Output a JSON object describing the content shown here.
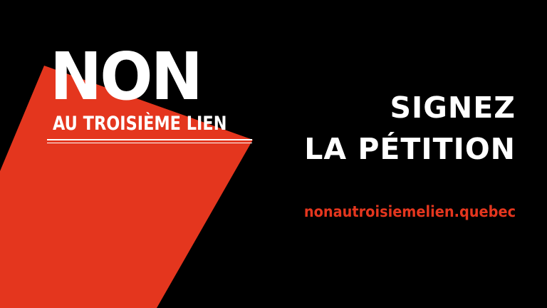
{
  "logo": {
    "headline": "NON",
    "subline": "AU TROISIÈME LIEN"
  },
  "call_to_action": {
    "line1": "SIGNEZ",
    "line2": "LA PÉTITION"
  },
  "website": "nonautroisiemelien.quebec",
  "colors": {
    "background": "#000000",
    "accent": "#e4361e",
    "text": "#ffffff"
  }
}
